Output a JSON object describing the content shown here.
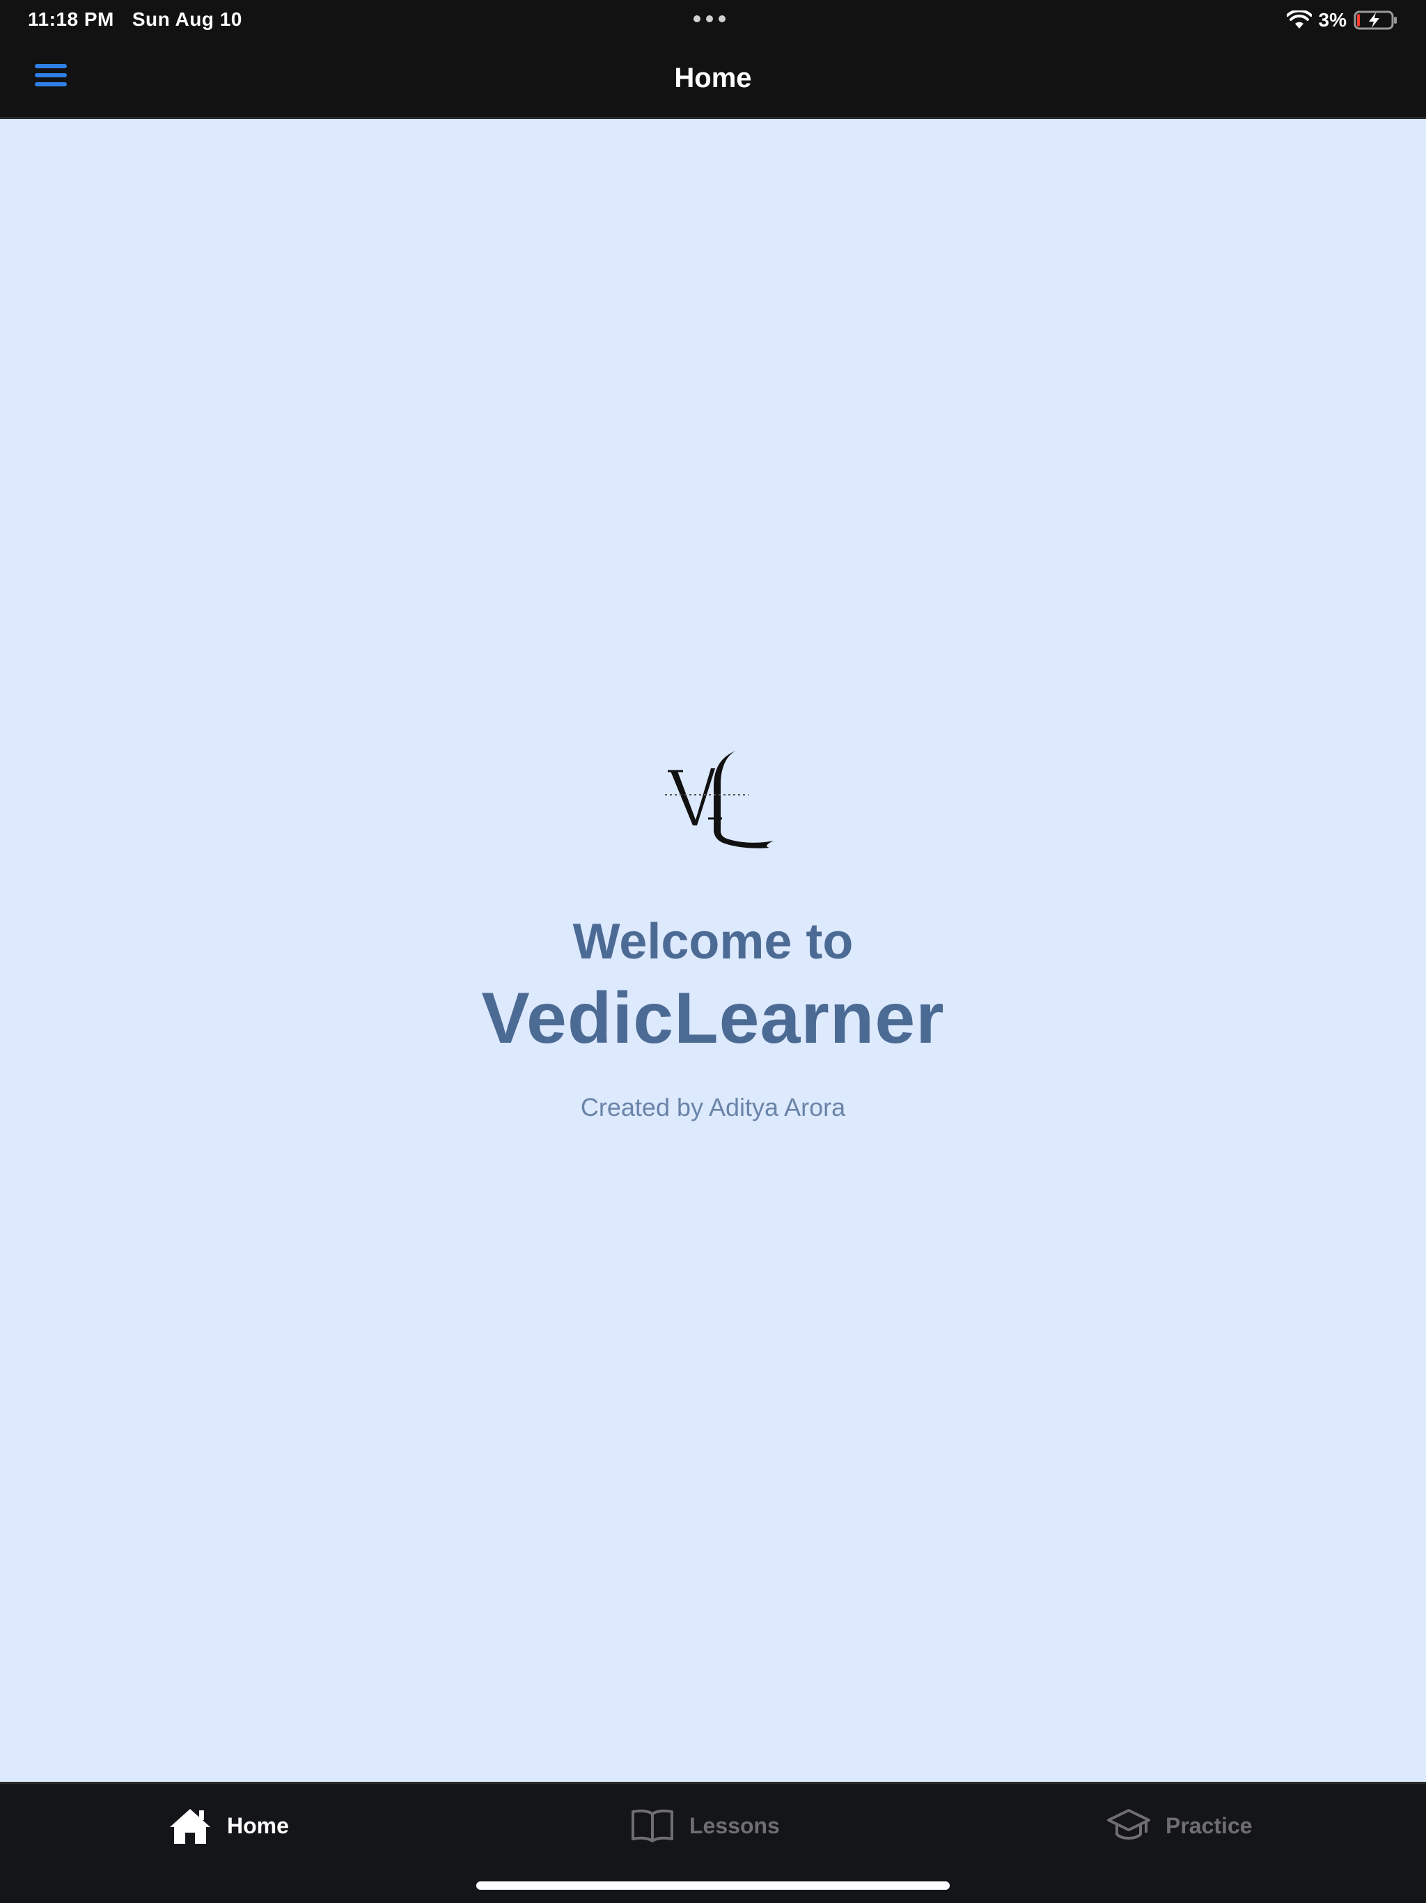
{
  "status_bar": {
    "time": "11:18 PM",
    "date": "Sun Aug 10",
    "battery_percent": "3%",
    "battery_level": 0.03,
    "charging": true
  },
  "nav": {
    "title": "Home",
    "menu_icon": "hamburger-menu-icon"
  },
  "main": {
    "logo_text": "VL",
    "welcome": "Welcome to",
    "app_name": "VedicLearner",
    "credit": "Created by Aditya Arora"
  },
  "tabs": [
    {
      "label": "Home",
      "icon": "home-icon",
      "active": true
    },
    {
      "label": "Lessons",
      "icon": "book-icon",
      "active": false
    },
    {
      "label": "Practice",
      "icon": "graduation-cap-icon",
      "active": false
    }
  ],
  "colors": {
    "bar_background": "#121212",
    "content_background": "#dde9fd",
    "accent": "#2f80e6",
    "heading": "#4c6b94",
    "inactive_tab": "#6f6f72"
  }
}
